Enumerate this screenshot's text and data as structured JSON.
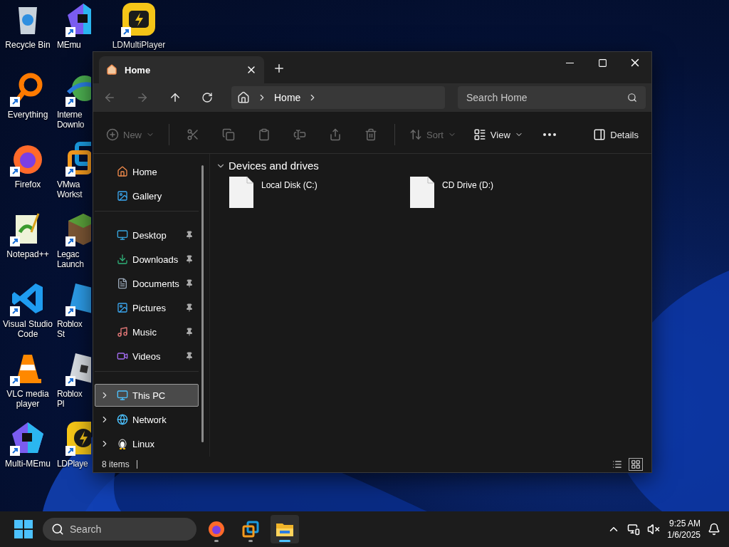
{
  "desktop": {
    "columns": [
      {
        "icons": [
          {
            "label": "Recycle Bin",
            "kind": "recycle-bin",
            "shortcut": false
          },
          {
            "label": "Everything",
            "kind": "ring",
            "shortcut": true
          },
          {
            "label": "Firefox",
            "kind": "fox",
            "shortcut": true
          },
          {
            "label": "Notepad++",
            "kind": "notepad",
            "shortcut": true
          },
          {
            "label": "Visual Studio Code",
            "kind": "code",
            "shortcut": true
          },
          {
            "label": "VLC media player",
            "kind": "cone",
            "shortcut": true
          },
          {
            "label": "Multi-MEmu",
            "kind": "pentagon",
            "shortcut": true
          }
        ]
      },
      {
        "icons": [
          {
            "label": "MEmu",
            "kind": "pentagon",
            "shortcut": true
          },
          {
            "label": "Interne Downlo",
            "kind": "globe",
            "shortcut": true
          },
          {
            "label": "VMwa Workst",
            "kind": "squares",
            "shortcut": true
          },
          {
            "label": "Legac Launch",
            "kind": "cube",
            "shortcut": true
          },
          {
            "label": "Roblox St",
            "kind": "studio",
            "shortcut": true
          },
          {
            "label": "Roblox Pl",
            "kind": "roblox",
            "shortcut": true
          },
          {
            "label": "LDPlaye",
            "kind": "bolt-ring",
            "shortcut": true
          }
        ]
      },
      {
        "icons": [
          {
            "label": "LDMultiPlayer",
            "kind": "bolt-tile",
            "shortcut": true
          }
        ]
      }
    ]
  },
  "window": {
    "tabs": [
      {
        "title": "Home",
        "selected": true
      }
    ],
    "nav": {
      "back_disabled": true,
      "forward_disabled": true,
      "breadcrumb": [
        "Home"
      ],
      "search": {
        "placeholder": "Search Home"
      }
    },
    "toolbar": [
      {
        "kind": "new",
        "label": "New",
        "disabled": true
      },
      {
        "kind": "divider"
      },
      {
        "kind": "cut",
        "disabled": true
      },
      {
        "kind": "copy",
        "disabled": true
      },
      {
        "kind": "paste",
        "disabled": true
      },
      {
        "kind": "rename",
        "disabled": true
      },
      {
        "kind": "share",
        "disabled": true
      },
      {
        "kind": "delete",
        "disabled": true
      },
      {
        "kind": "divider"
      },
      {
        "kind": "sort",
        "label": "Sort",
        "disabled": true
      },
      {
        "kind": "view",
        "label": "View",
        "disabled": false
      },
      {
        "kind": "more",
        "disabled": false
      },
      {
        "kind": "spacer"
      },
      {
        "kind": "details",
        "label": "Details",
        "disabled": false
      }
    ],
    "sidebar": {
      "groups": [
        {
          "items": [
            {
              "label": "Home",
              "kind": "home",
              "pinned": false,
              "expandable": false,
              "selected": false
            },
            {
              "label": "Gallery",
              "kind": "gallery",
              "pinned": false,
              "expandable": false,
              "selected": false
            }
          ]
        },
        {
          "items": [
            {
              "label": "Desktop",
              "kind": "desktop",
              "pinned": true,
              "expandable": false,
              "selected": false
            },
            {
              "label": "Downloads",
              "kind": "downloads",
              "pinned": true,
              "expandable": false,
              "selected": false
            },
            {
              "label": "Documents",
              "kind": "documents",
              "pinned": true,
              "expandable": false,
              "selected": false
            },
            {
              "label": "Pictures",
              "kind": "pictures",
              "pinned": true,
              "expandable": false,
              "selected": false
            },
            {
              "label": "Music",
              "kind": "music",
              "pinned": true,
              "expandable": false,
              "selected": false
            },
            {
              "label": "Videos",
              "kind": "videos",
              "pinned": true,
              "expandable": false,
              "selected": false
            }
          ]
        },
        {
          "items": [
            {
              "label": "This PC",
              "kind": "pc",
              "pinned": false,
              "expandable": true,
              "selected": true
            },
            {
              "label": "Network",
              "kind": "network",
              "pinned": false,
              "expandable": true,
              "selected": false
            },
            {
              "label": "Linux",
              "kind": "linux",
              "pinned": false,
              "expandable": true,
              "selected": false
            }
          ]
        }
      ]
    },
    "content": {
      "sections": [
        {
          "title": "Devices and drives",
          "expanded": true,
          "items": [
            {
              "name": "Local Disk (C:)"
            },
            {
              "name": "CD Drive (D:)"
            }
          ]
        }
      ]
    },
    "status_bar": {
      "count": "8 items",
      "views": [
        {
          "selected": false
        },
        {
          "selected": true
        }
      ]
    }
  },
  "taskbar": {
    "search": {
      "placeholder": "Search"
    },
    "apps": [
      {
        "kind": "fox",
        "active": false
      },
      {
        "kind": "squares",
        "active": false
      },
      {
        "kind": "folder",
        "active": true
      }
    ],
    "time": "9:25 AM",
    "date": "1/6/2025"
  }
}
